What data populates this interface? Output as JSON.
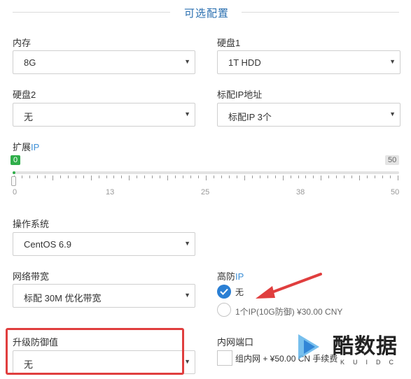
{
  "section": {
    "title": "可选配置"
  },
  "fields": {
    "memory": {
      "label": "内存",
      "value": "8G"
    },
    "disk1": {
      "label": "硬盘1",
      "value": "1T HDD"
    },
    "disk2": {
      "label": "硬盘2",
      "value": "无"
    },
    "std_ip": {
      "label": "标配IP地址",
      "value": "标配IP 3个"
    },
    "os": {
      "label": "操作系统",
      "value": "CentOS 6.9"
    },
    "bandwidth": {
      "label": "网络带宽",
      "value": "标配 30M 优化带宽"
    },
    "defense": {
      "label": "升级防御值",
      "value": "无"
    }
  },
  "ext_ip": {
    "label_main": "扩展",
    "label_accent": "IP",
    "current_value": 0,
    "min_badge": "0",
    "max_badge": "50",
    "ticks": [
      "0",
      "13",
      "25",
      "38",
      "50"
    ]
  },
  "high_def_ip": {
    "label_main": "高防",
    "label_accent": "IP",
    "options": [
      {
        "label": "无",
        "selected": true
      },
      {
        "label": "1个IP(10G防御) ¥30.00 CNY",
        "selected": false
      }
    ]
  },
  "intranet": {
    "label": "内网端口",
    "option_label": "组内网 + ¥50.00 CN 手续费",
    "checked": false
  },
  "watermark": {
    "text": "酷数据",
    "sub": "KUIDC"
  },
  "colors": {
    "accent": "#2a7fd4",
    "slider_green": "#2fae4a",
    "annotation_red": "#e03e3e"
  }
}
